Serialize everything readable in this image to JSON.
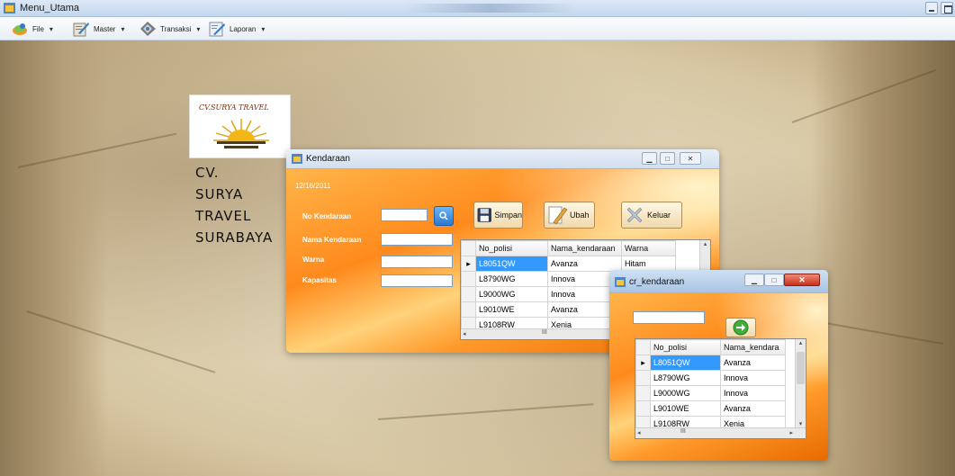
{
  "main_window": {
    "title": "Menu_Utama",
    "menus": [
      {
        "label": "File",
        "icon": "file-icon"
      },
      {
        "label": "Master",
        "icon": "master-icon"
      },
      {
        "label": "Transaksi",
        "icon": "transaksi-icon"
      },
      {
        "label": "Laporan",
        "icon": "laporan-icon"
      }
    ]
  },
  "company": {
    "logo_text": "CV.SURYA TRAVEL",
    "lines": [
      "CV.",
      "SURYA",
      "TRAVEL",
      "SURABAYA"
    ]
  },
  "kendaraan_form": {
    "title": "Kendaraan",
    "date": "12/16/2011",
    "labels": {
      "no_kendaraan": "No Kendaraan",
      "nama_kendaraan": "Nama Kendaraan",
      "warna": "Warna",
      "kapasitas": "Kapasitas"
    },
    "buttons": {
      "simpan": "Simpan",
      "ubah": "Ubah",
      "keluar": "Keluar"
    },
    "grid": {
      "columns": [
        "No_polisi",
        "Nama_kendaraan",
        "Warna"
      ],
      "rows": [
        [
          "L8051QW",
          "Avanza",
          "Hitam"
        ],
        [
          "L8790WG",
          "Innova",
          ""
        ],
        [
          "L9000WG",
          "Innova",
          ""
        ],
        [
          "L9010WE",
          "Avanza",
          ""
        ],
        [
          "L9108RW",
          "Xenia",
          ""
        ]
      ],
      "scroll_text": "III"
    }
  },
  "cr_kendaraan": {
    "title": "cr_kendaraan",
    "grid": {
      "columns": [
        "No_polisi",
        "Nama_kendara"
      ],
      "rows": [
        [
          "L8051QW",
          "Avanza"
        ],
        [
          "L8790WG",
          "Innova"
        ],
        [
          "L9000WG",
          "Innova"
        ],
        [
          "L9010WE",
          "Avanza"
        ],
        [
          "L9108RW",
          "Xenia"
        ]
      ],
      "scroll_text": "III"
    }
  },
  "colors": {
    "accent_orange": "#ff8a1c",
    "selection_blue": "#3399ff",
    "search_button_blue": "#3a8fe0",
    "close_red": "#d9452f"
  }
}
